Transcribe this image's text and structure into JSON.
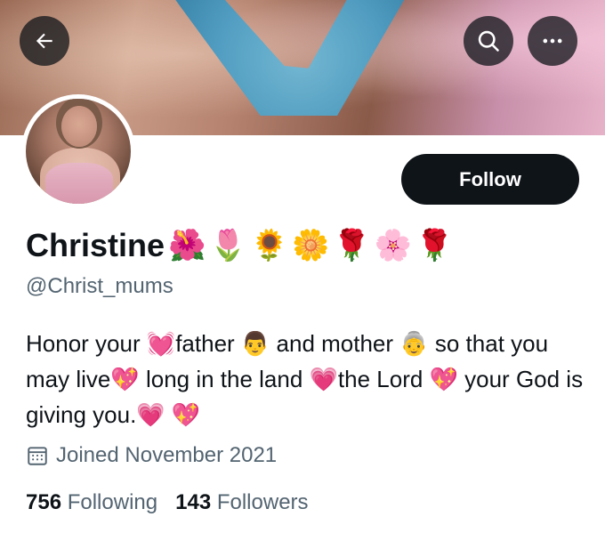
{
  "header": {
    "back_icon": "arrow-left-icon",
    "search_icon": "search-icon",
    "more_icon": "more-horizontal-icon"
  },
  "profile": {
    "name": "Christine",
    "name_emojis": "🌺🌷🌻🌼🌹🌸🌹",
    "handle": "@Christ_mums",
    "follow_label": "Follow",
    "bio": "Honor your 💓father 👨 and mother 👵 so that you may live💖 long in the land 💗the Lord 💖 your God is giving you.💗 💖",
    "joined": "Joined November 2021",
    "following_count": "756",
    "following_label": "Following",
    "followers_count": "143",
    "followers_label": "Followers"
  },
  "colors": {
    "text": "#0f1419",
    "muted": "#536471",
    "button": "#0f1419"
  }
}
